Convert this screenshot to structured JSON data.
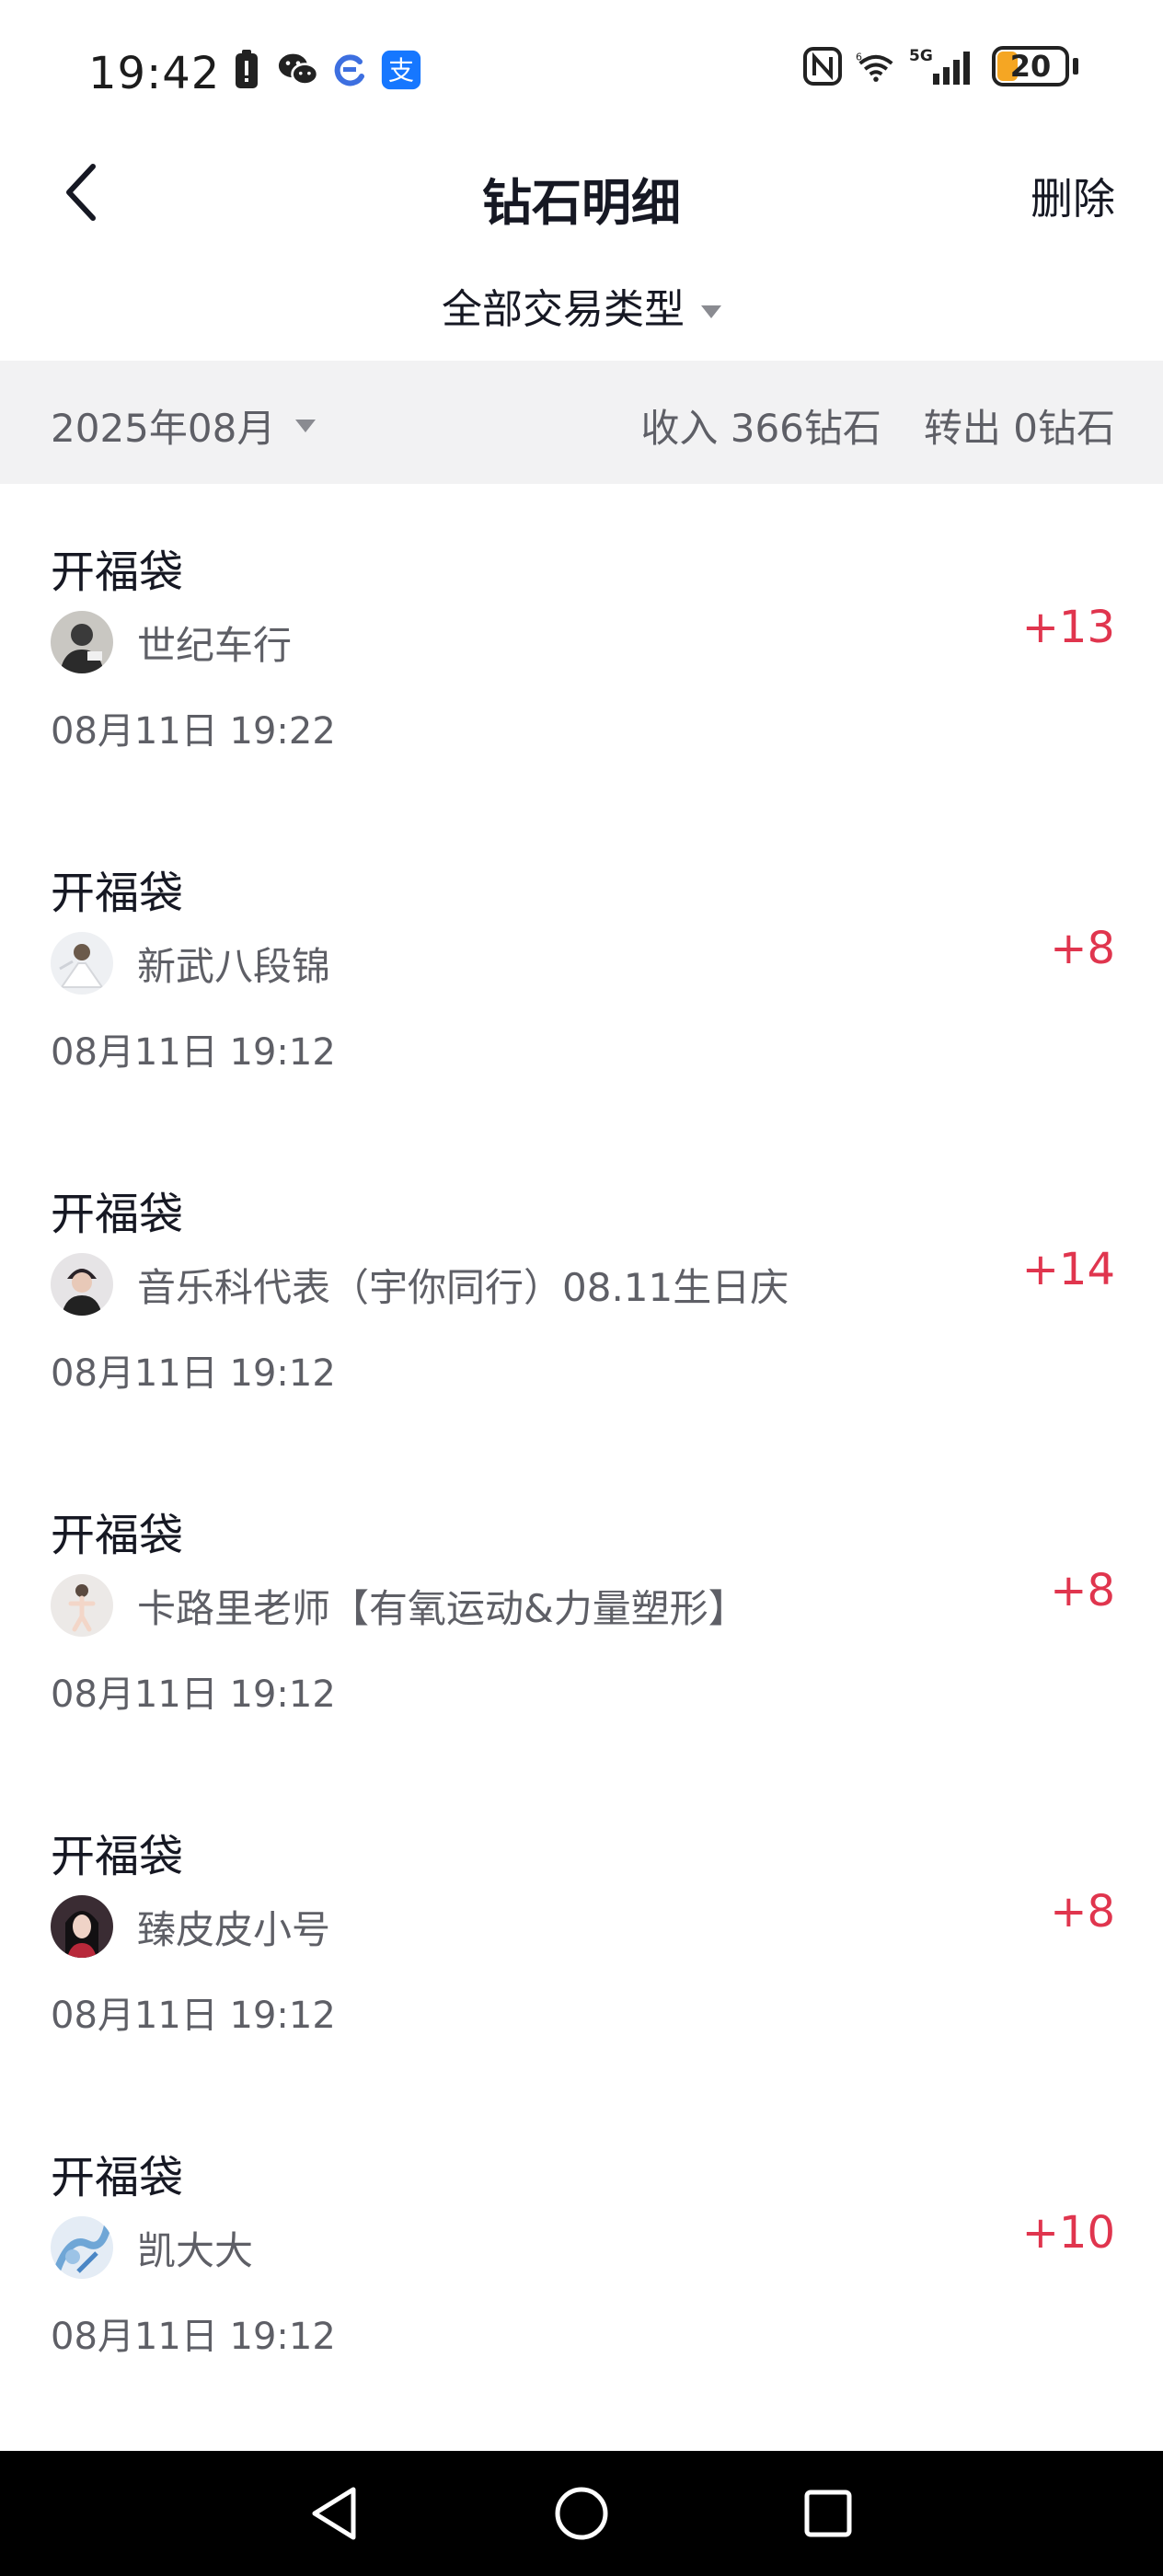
{
  "status_bar": {
    "time": "19:42",
    "left_icons": [
      "battery-alert-icon",
      "wechat-icon",
      "app-c-icon",
      "alipay-icon"
    ],
    "right_icons": [
      "nfc-icon",
      "wifi-icon",
      "signal-5g-icon"
    ],
    "battery_level": "20",
    "alipay_glyph": "支"
  },
  "header": {
    "title": "钻石明细",
    "delete_label": "删除"
  },
  "filter": {
    "type_label": "全部交易类型"
  },
  "summary": {
    "month": "2025年08月",
    "income": "收入 366钻石",
    "outgoing": "转出 0钻石"
  },
  "transactions": [
    {
      "title": "开福袋",
      "user": "世纪车行",
      "time": "08月11日 19:22",
      "amount": "+13"
    },
    {
      "title": "开福袋",
      "user": "新武八段锦",
      "time": "08月11日 19:12",
      "amount": "+8"
    },
    {
      "title": "开福袋",
      "user": "音乐科代表（宇你同行）08.11生日庆",
      "time": "08月11日 19:12",
      "amount": "+14"
    },
    {
      "title": "开福袋",
      "user": "卡路里老师【有氧运动&力量塑形】",
      "time": "08月11日 19:12",
      "amount": "+8"
    },
    {
      "title": "开福袋",
      "user": "臻皮皮小号",
      "time": "08月11日 19:12",
      "amount": "+8"
    },
    {
      "title": "开福袋",
      "user": "凯大大",
      "time": "08月11日 19:12",
      "amount": "+10"
    }
  ],
  "colors": {
    "amount": "#e0354e",
    "summary_bg": "#f2f2f3",
    "secondary_text": "#5e5f66"
  }
}
